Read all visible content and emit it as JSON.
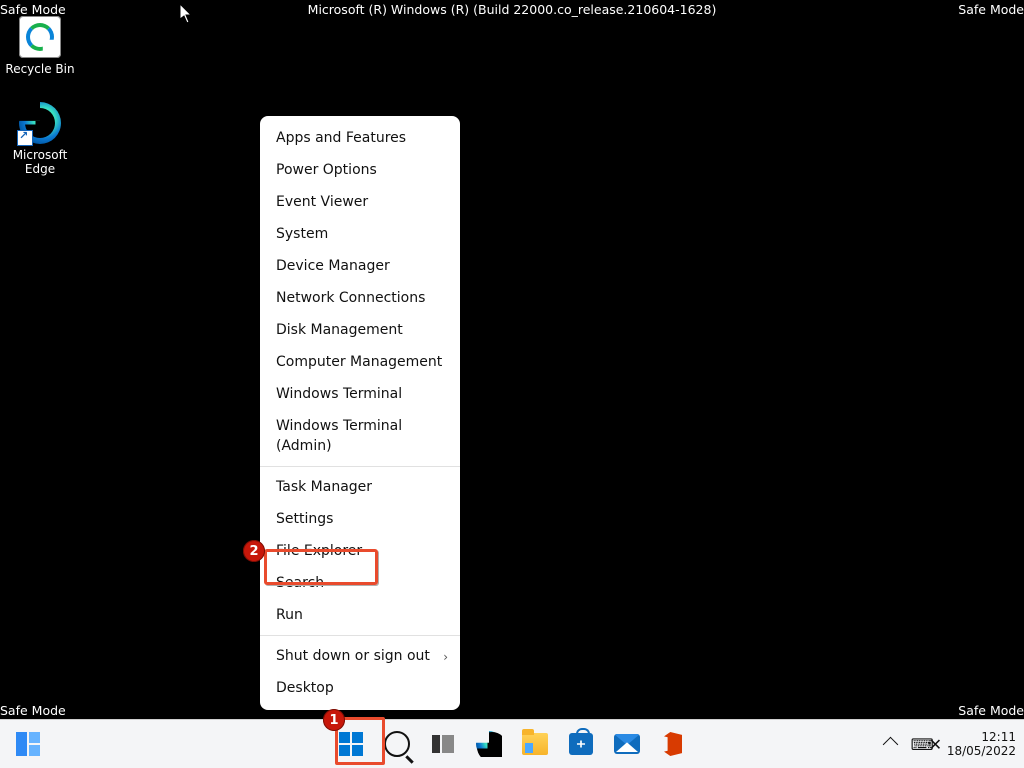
{
  "corners": {
    "safemode": "Safe Mode",
    "build": "Microsoft (R) Windows (R) (Build 22000.co_release.210604-1628)"
  },
  "desktop_icons": {
    "recycle": "Recycle Bin",
    "edge": "Microsoft Edge"
  },
  "winx_menu": {
    "group1": [
      "Apps and Features",
      "Power Options",
      "Event Viewer",
      "System",
      "Device Manager",
      "Network Connections",
      "Disk Management",
      "Computer Management",
      "Windows Terminal",
      "Windows Terminal (Admin)"
    ],
    "group2": [
      "Task Manager",
      "Settings",
      "File Explorer",
      "Search",
      "Run"
    ],
    "group3_submenu": "Shut down or sign out",
    "group3_last": "Desktop"
  },
  "annotations": {
    "one": "1",
    "two": "2"
  },
  "tray": {
    "time": "12:11",
    "date": "18/05/2022"
  }
}
